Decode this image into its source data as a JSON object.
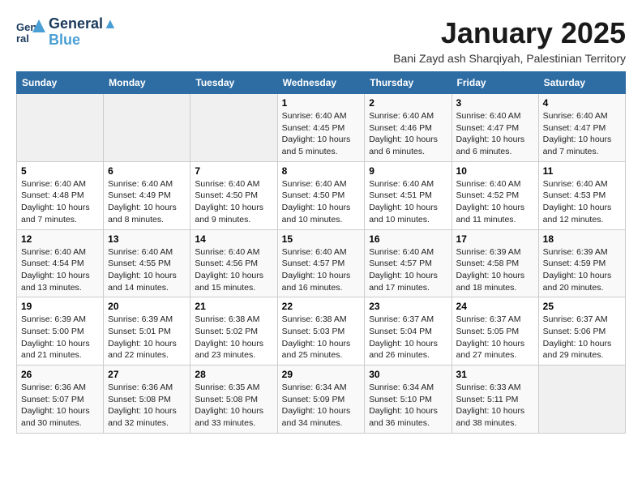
{
  "logo": {
    "line1": "General",
    "line2": "Blue",
    "symbol": "▲"
  },
  "title": "January 2025",
  "subtitle": "Bani Zayd ash Sharqiyah, Palestinian Territory",
  "days_of_week": [
    "Sunday",
    "Monday",
    "Tuesday",
    "Wednesday",
    "Thursday",
    "Friday",
    "Saturday"
  ],
  "weeks": [
    [
      {
        "day": "",
        "info": ""
      },
      {
        "day": "",
        "info": ""
      },
      {
        "day": "",
        "info": ""
      },
      {
        "day": "1",
        "info": "Sunrise: 6:40 AM\nSunset: 4:45 PM\nDaylight: 10 hours and 5 minutes."
      },
      {
        "day": "2",
        "info": "Sunrise: 6:40 AM\nSunset: 4:46 PM\nDaylight: 10 hours and 6 minutes."
      },
      {
        "day": "3",
        "info": "Sunrise: 6:40 AM\nSunset: 4:47 PM\nDaylight: 10 hours and 6 minutes."
      },
      {
        "day": "4",
        "info": "Sunrise: 6:40 AM\nSunset: 4:47 PM\nDaylight: 10 hours and 7 minutes."
      }
    ],
    [
      {
        "day": "5",
        "info": "Sunrise: 6:40 AM\nSunset: 4:48 PM\nDaylight: 10 hours and 7 minutes."
      },
      {
        "day": "6",
        "info": "Sunrise: 6:40 AM\nSunset: 4:49 PM\nDaylight: 10 hours and 8 minutes."
      },
      {
        "day": "7",
        "info": "Sunrise: 6:40 AM\nSunset: 4:50 PM\nDaylight: 10 hours and 9 minutes."
      },
      {
        "day": "8",
        "info": "Sunrise: 6:40 AM\nSunset: 4:50 PM\nDaylight: 10 hours and 10 minutes."
      },
      {
        "day": "9",
        "info": "Sunrise: 6:40 AM\nSunset: 4:51 PM\nDaylight: 10 hours and 10 minutes."
      },
      {
        "day": "10",
        "info": "Sunrise: 6:40 AM\nSunset: 4:52 PM\nDaylight: 10 hours and 11 minutes."
      },
      {
        "day": "11",
        "info": "Sunrise: 6:40 AM\nSunset: 4:53 PM\nDaylight: 10 hours and 12 minutes."
      }
    ],
    [
      {
        "day": "12",
        "info": "Sunrise: 6:40 AM\nSunset: 4:54 PM\nDaylight: 10 hours and 13 minutes."
      },
      {
        "day": "13",
        "info": "Sunrise: 6:40 AM\nSunset: 4:55 PM\nDaylight: 10 hours and 14 minutes."
      },
      {
        "day": "14",
        "info": "Sunrise: 6:40 AM\nSunset: 4:56 PM\nDaylight: 10 hours and 15 minutes."
      },
      {
        "day": "15",
        "info": "Sunrise: 6:40 AM\nSunset: 4:57 PM\nDaylight: 10 hours and 16 minutes."
      },
      {
        "day": "16",
        "info": "Sunrise: 6:40 AM\nSunset: 4:57 PM\nDaylight: 10 hours and 17 minutes."
      },
      {
        "day": "17",
        "info": "Sunrise: 6:39 AM\nSunset: 4:58 PM\nDaylight: 10 hours and 18 minutes."
      },
      {
        "day": "18",
        "info": "Sunrise: 6:39 AM\nSunset: 4:59 PM\nDaylight: 10 hours and 20 minutes."
      }
    ],
    [
      {
        "day": "19",
        "info": "Sunrise: 6:39 AM\nSunset: 5:00 PM\nDaylight: 10 hours and 21 minutes."
      },
      {
        "day": "20",
        "info": "Sunrise: 6:39 AM\nSunset: 5:01 PM\nDaylight: 10 hours and 22 minutes."
      },
      {
        "day": "21",
        "info": "Sunrise: 6:38 AM\nSunset: 5:02 PM\nDaylight: 10 hours and 23 minutes."
      },
      {
        "day": "22",
        "info": "Sunrise: 6:38 AM\nSunset: 5:03 PM\nDaylight: 10 hours and 25 minutes."
      },
      {
        "day": "23",
        "info": "Sunrise: 6:37 AM\nSunset: 5:04 PM\nDaylight: 10 hours and 26 minutes."
      },
      {
        "day": "24",
        "info": "Sunrise: 6:37 AM\nSunset: 5:05 PM\nDaylight: 10 hours and 27 minutes."
      },
      {
        "day": "25",
        "info": "Sunrise: 6:37 AM\nSunset: 5:06 PM\nDaylight: 10 hours and 29 minutes."
      }
    ],
    [
      {
        "day": "26",
        "info": "Sunrise: 6:36 AM\nSunset: 5:07 PM\nDaylight: 10 hours and 30 minutes."
      },
      {
        "day": "27",
        "info": "Sunrise: 6:36 AM\nSunset: 5:08 PM\nDaylight: 10 hours and 32 minutes."
      },
      {
        "day": "28",
        "info": "Sunrise: 6:35 AM\nSunset: 5:08 PM\nDaylight: 10 hours and 33 minutes."
      },
      {
        "day": "29",
        "info": "Sunrise: 6:34 AM\nSunset: 5:09 PM\nDaylight: 10 hours and 34 minutes."
      },
      {
        "day": "30",
        "info": "Sunrise: 6:34 AM\nSunset: 5:10 PM\nDaylight: 10 hours and 36 minutes."
      },
      {
        "day": "31",
        "info": "Sunrise: 6:33 AM\nSunset: 5:11 PM\nDaylight: 10 hours and 38 minutes."
      },
      {
        "day": "",
        "info": ""
      }
    ]
  ]
}
